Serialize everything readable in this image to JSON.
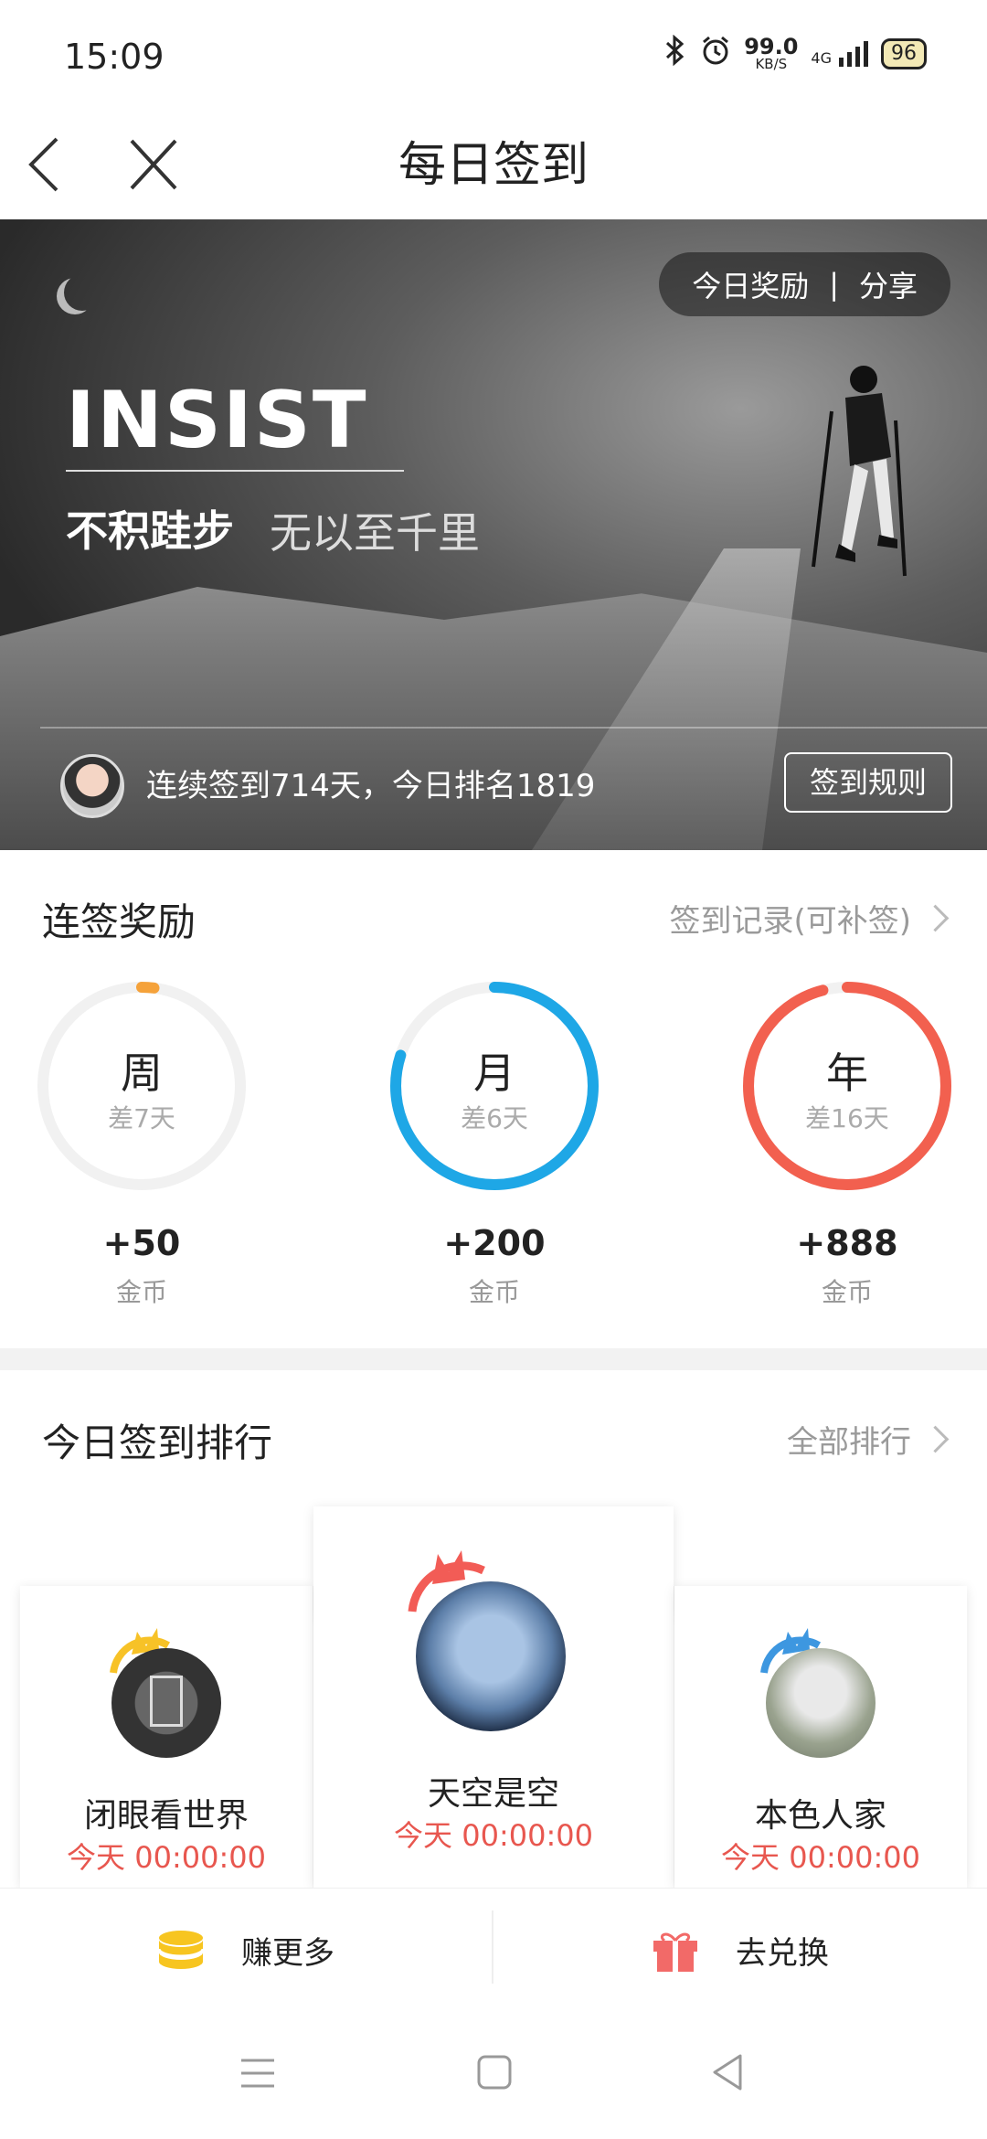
{
  "status_bar": {
    "time": "15:09",
    "net_speed": "99.0",
    "net_unit": "KB/S",
    "signal": "4G",
    "battery": "96"
  },
  "nav": {
    "title": "每日签到",
    "back_icon": "chevron-left-icon",
    "close_icon": "close-icon"
  },
  "banner": {
    "today_reward": "今日奖励",
    "separator": "|",
    "share": "分享",
    "headline": "INSIST",
    "motto_main": "不积跬步",
    "motto_sub": "无以至千里",
    "streak_text": "连续签到714天，今日排名1819",
    "rules_button": "签到规则"
  },
  "rewards": {
    "title": "连签奖励",
    "record_link": "签到记录(可补签)",
    "items": [
      {
        "label": "周",
        "remaining": "差7天",
        "amount": "+50",
        "unit": "金币",
        "progress": 0.02,
        "color": "#f5a23a"
      },
      {
        "label": "月",
        "remaining": "差6天",
        "amount": "+200",
        "unit": "金币",
        "progress": 0.8,
        "color": "#1ea7e6"
      },
      {
        "label": "年",
        "remaining": "差16天",
        "amount": "+888",
        "unit": "金币",
        "progress": 0.96,
        "color": "#f2604f"
      }
    ]
  },
  "ranking": {
    "title": "今日签到排行",
    "all_link": "全部排行",
    "entries": [
      {
        "rank": 2,
        "name": "闭眼看世界",
        "time": "今天 00:00:00",
        "crown_color": "#f7c227"
      },
      {
        "rank": 1,
        "name": "天空是空",
        "time": "今天 00:00:00",
        "crown_color": "#f25c56"
      },
      {
        "rank": 3,
        "name": "本色人家",
        "time": "今天 00:00:00",
        "crown_color": "#3d97e0"
      }
    ]
  },
  "bottom": {
    "earn": "赚更多",
    "exchange": "去兑换"
  },
  "colors": {
    "accent_red": "#e8574f",
    "coin_yellow": "#f7c520",
    "gift_red": "#f26a68"
  }
}
